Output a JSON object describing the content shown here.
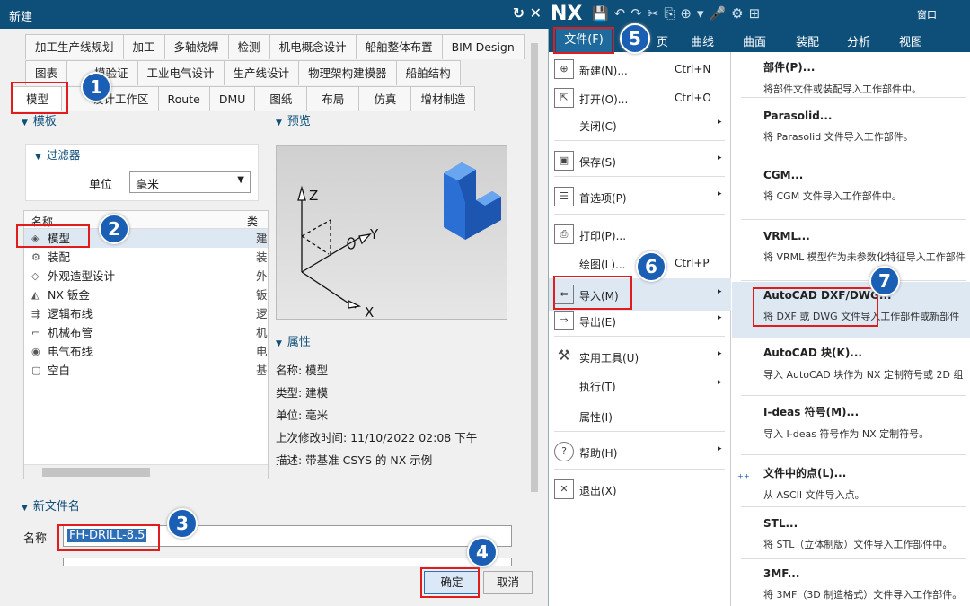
{
  "dialog": {
    "title": "新建",
    "title_icons": "↻ ✕",
    "tabs_row1": [
      "加工生产线规划",
      "加工",
      "多轴烧焊",
      "检测",
      "机电概念设计",
      "船舶整体布置",
      "BIM Design"
    ],
    "tabs_row2": [
      "图表",
      "模验证",
      "工业电气设计",
      "生产线设计",
      "物理架构建模器",
      "船舶结构"
    ],
    "tabs_row3": [
      "模型",
      "设计工作区",
      "Route",
      "DMU",
      "图纸",
      "布局",
      "仿真",
      "增材制造"
    ],
    "templates_header": "模板",
    "filter_header": "过滤器",
    "unit_label": "单位",
    "unit_value": "毫米",
    "list_col_name": "名称",
    "list_col_type": "类",
    "templates": [
      {
        "name": "模型",
        "type": "建"
      },
      {
        "name": "装配",
        "type": "装"
      },
      {
        "name": "外观造型设计",
        "type": "外"
      },
      {
        "name": "NX 钣金",
        "type": "钣"
      },
      {
        "name": "逻辑布线",
        "type": "逻"
      },
      {
        "name": "机械布管",
        "type": "机"
      },
      {
        "name": "电气布线",
        "type": "电"
      },
      {
        "name": "空白",
        "type": "基"
      }
    ],
    "preview_header": "预览",
    "preview_axes": {
      "z": "Z",
      "y": "Y",
      "x": "X"
    },
    "properties_header": "属性",
    "props": {
      "name": "名称:  模型",
      "type": "类型:  建模",
      "unit": "单位:  毫米",
      "modified": "上次修改时间:  11/10/2022 02:08 下午",
      "desc": "描述:  带基准 CSYS 的 NX 示例"
    },
    "newfile_header": "新文件名",
    "name_label": "名称",
    "name_value": "FH-DRILL-8.5",
    "ok_label": "确定",
    "cancel_label": "取消"
  },
  "nx": {
    "logo": "NX",
    "window_label": "窗口",
    "ribbon": [
      "页",
      "曲线",
      "曲面",
      "装配",
      "分析",
      "视图"
    ],
    "file_tab": "文件(F)",
    "menu": [
      {
        "label": "新建(N)...",
        "shortcut": "Ctrl+N",
        "icon": "new-file-icon",
        "arrow": ""
      },
      {
        "label": "打开(O)...",
        "shortcut": "Ctrl+O",
        "icon": "open-folder-icon",
        "arrow": ""
      },
      {
        "label": "关闭(C)",
        "shortcut": "",
        "icon": "",
        "arrow": "▸"
      },
      {
        "label": "保存(S)",
        "shortcut": "",
        "icon": "save-icon",
        "arrow": "▸"
      },
      {
        "label": "首选项(P)",
        "shortcut": "",
        "icon": "preferences-icon",
        "arrow": "▸"
      },
      {
        "label": "打印(P)...",
        "shortcut": "",
        "icon": "print-icon",
        "arrow": ""
      },
      {
        "label": "绘图(L)...",
        "shortcut": "Ctrl+P",
        "icon": "",
        "arrow": ""
      },
      {
        "label": "导入(M)",
        "shortcut": "",
        "icon": "import-icon",
        "arrow": "▸"
      },
      {
        "label": "导出(E)",
        "shortcut": "",
        "icon": "export-icon",
        "arrow": "▸"
      },
      {
        "label": "实用工具(U)",
        "shortcut": "",
        "icon": "tools-icon",
        "arrow": "▸"
      },
      {
        "label": "执行(T)",
        "shortcut": "",
        "icon": "",
        "arrow": "▸"
      },
      {
        "label": "属性(I)",
        "shortcut": "",
        "icon": "",
        "arrow": ""
      },
      {
        "label": "帮助(H)",
        "shortcut": "",
        "icon": "help-icon",
        "arrow": "▸"
      },
      {
        "label": "退出(X)",
        "shortcut": "",
        "icon": "exit-icon",
        "arrow": ""
      }
    ],
    "submenu": [
      {
        "title": "部件(P)...",
        "desc": "将部件文件或装配导入工作部件中。"
      },
      {
        "title": "Parasolid...",
        "desc": "将 Parasolid 文件导入工作部件。"
      },
      {
        "title": "CGM...",
        "desc": "将 CGM 文件导入工作部件中。"
      },
      {
        "title": "VRML...",
        "desc": "将 VRML 模型作为未参数化特征导入工作部件"
      },
      {
        "title": "AutoCAD DXF/DWG...",
        "desc": "将 DXF 或 DWG 文件导入工作部件或新部件"
      },
      {
        "title": "AutoCAD 块(K)...",
        "desc": "导入 AutoCAD 块作为 NX 定制符号或 2D 组"
      },
      {
        "title": "I-deas 符号(M)...",
        "desc": "导入 I-deas 符号作为 NX 定制符号。"
      },
      {
        "title": "文件中的点(L)...",
        "desc": "从 ASCII 文件导入点。"
      },
      {
        "title": "STL...",
        "desc": "将 STL（立体制版）文件导入工作部件中。"
      },
      {
        "title": "3MF...",
        "desc": "将 3MF（3D 制造格式）文件导入工作部件。"
      }
    ]
  },
  "badges": [
    "1",
    "2",
    "3",
    "4",
    "5",
    "6",
    "7"
  ],
  "colors": {
    "titlebar": "#0e4f7a",
    "annotation_red": "#e01c1c",
    "badge_blue": "#1a5fb4",
    "selection": "#dde8f3"
  }
}
